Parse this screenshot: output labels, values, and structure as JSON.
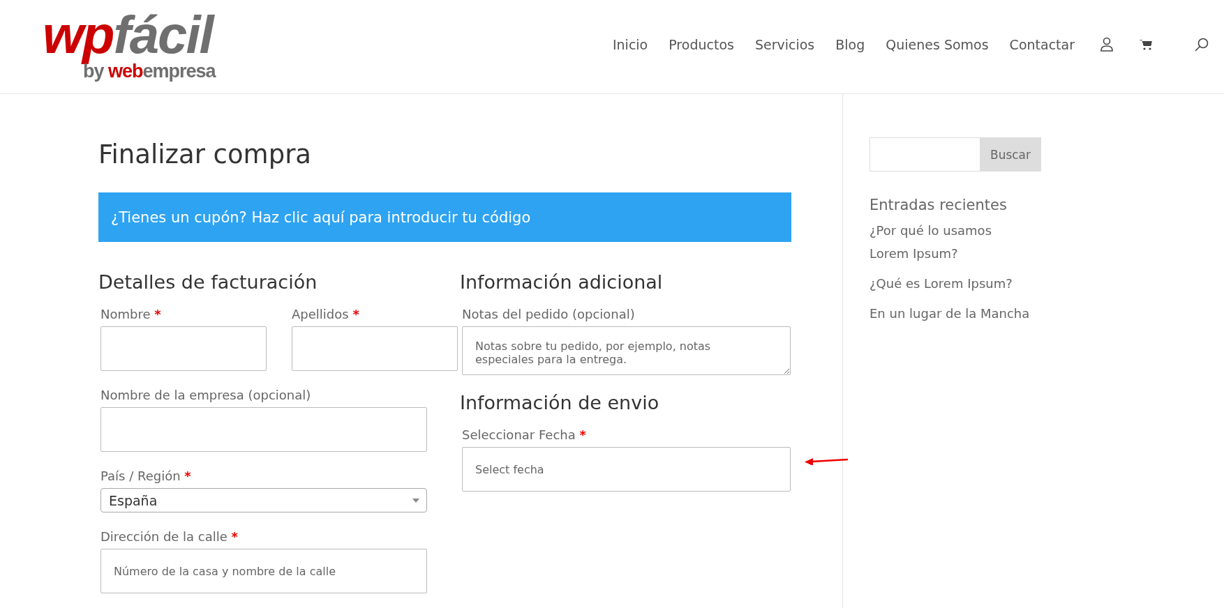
{
  "header": {
    "logo": {
      "wordmark": [
        {
          "text": "wp",
          "color": "#cc0000"
        },
        {
          "text": "fácil",
          "color": "#6f6f6f"
        }
      ],
      "tagline": [
        {
          "text": "by ",
          "color": "#6f6f6f"
        },
        {
          "text": "web",
          "color": "#cc0000"
        },
        {
          "text": "empresa",
          "color": "#6f6f6f"
        }
      ]
    },
    "nav": [
      "Inicio",
      "Productos",
      "Servicios",
      "Blog",
      "Quienes Somos",
      "Contactar"
    ]
  },
  "page_title": "Finalizar compra",
  "coupon_notice": "¿Tienes un cupón? Haz clic aquí para introducir tu código",
  "billing": {
    "heading": "Detalles de facturación",
    "rows": [
      [
        {
          "kind": "input",
          "label": "Nombre",
          "mark": "*"
        },
        {
          "kind": "input",
          "label": "Apellidos",
          "mark": "*"
        }
      ],
      [
        {
          "kind": "input",
          "label": "Nombre de la empresa (opcional)"
        }
      ],
      [
        {
          "kind": "select",
          "label": "País / Región",
          "mark": "*",
          "value": "España"
        }
      ],
      [
        {
          "kind": "input",
          "label": "Dirección de la calle",
          "mark": "*",
          "placeholder": "Número de la casa y nombre de la calle"
        }
      ]
    ]
  },
  "sections": [
    {
      "heading": "Información adicional",
      "fields": [
        {
          "kind": "textarea",
          "label": "Notas del pedido (opcional)",
          "placeholder": "Notas sobre tu pedido, por ejemplo, notas especiales para la entrega."
        }
      ]
    },
    {
      "heading": "Información de envio",
      "fields": [
        {
          "kind": "input",
          "label": "Seleccionar Fecha",
          "mark": "*",
          "placeholder": "Select fecha"
        }
      ]
    }
  ],
  "sidebar": {
    "search_button": "Buscar",
    "recent_heading": "Entradas recientes",
    "recent_posts": [
      "¿Por qué lo usamos Lorem Ipsum?",
      "¿Qué es Lorem Ipsum?",
      "En un lugar de la Mancha"
    ]
  }
}
